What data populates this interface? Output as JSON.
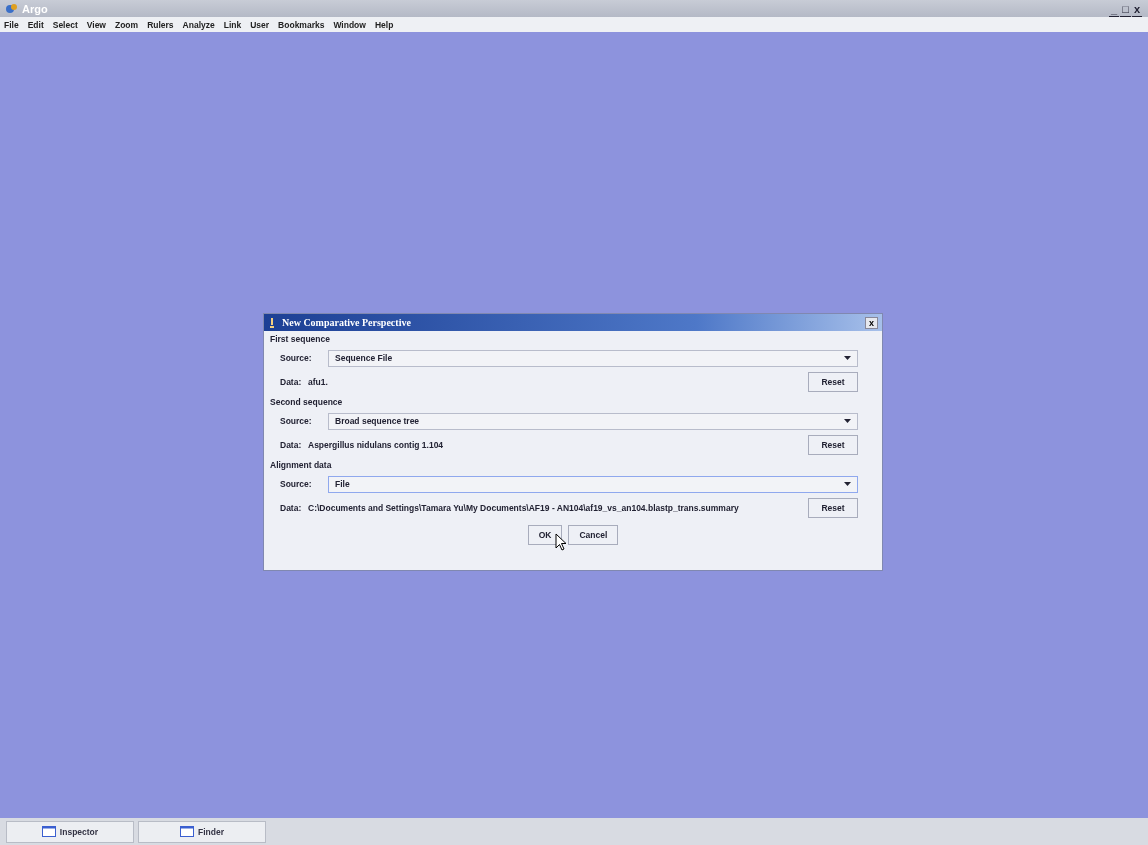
{
  "window": {
    "title": "Argo"
  },
  "menu": [
    "File",
    "Edit",
    "Select",
    "View",
    "Zoom",
    "Rulers",
    "Analyze",
    "Link",
    "User",
    "Bookmarks",
    "Window",
    "Help"
  ],
  "window_controls": [
    "_",
    "□",
    "x"
  ],
  "dialog": {
    "title": "New Comparative Perspective",
    "close": "x",
    "sections": [
      {
        "heading": "First sequence",
        "source_label": "Source:",
        "source": "Sequence File",
        "focused": false,
        "data_label": "Data:",
        "data": "afu1.",
        "reset": "Reset"
      },
      {
        "heading": "Second sequence",
        "source_label": "Source:",
        "source": "Broad sequence tree",
        "focused": false,
        "data_label": "Data:",
        "data": "Aspergillus nidulans contig 1.104",
        "reset": "Reset"
      },
      {
        "heading": "Alignment data",
        "source_label": "Source:",
        "source": "File",
        "focused": true,
        "data_label": "Data:",
        "data": "C:\\Documents and Settings\\Tamara Yu\\My Documents\\AF19 - AN104\\af19_vs_an104.blastp_trans.summary",
        "reset": "Reset"
      }
    ],
    "buttons": [
      "OK",
      "Cancel"
    ]
  },
  "taskbar": [
    {
      "label": "Inspector"
    },
    {
      "label": "Finder"
    }
  ]
}
